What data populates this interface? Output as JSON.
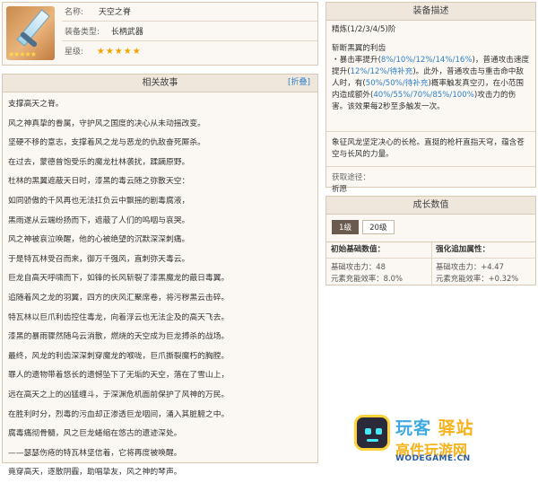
{
  "weapon": {
    "name_key": "名称:",
    "name": "天空之脊",
    "type_key": "装备类型:",
    "type": "长柄武器",
    "stars_key": "星级:",
    "stars": "★★★★★",
    "icon_stars": "★★★★★"
  },
  "story": {
    "title": "相关故事",
    "toggle": "[折叠]",
    "lines": [
      "支撑高天之脊。",
      "风之神真挚的眷属，守护风之国度的决心从未动摇改变。",
      "坚硬不移的意志，支撑着风之龙与恶龙的仇敌奋死厮杀。",
      "在过去，蒙德曾饱受乐的魔龙杜林袭扰，蹂躏原野。",
      "杜林的黑翼遮蔽天日时，漆黑的毒云随之弥散天空：",
      "如同骄傲的千风再也无法扛负云中飘摇的剧毒腐液，",
      "黑雨遂从云端纷扬而下，遮蔽了人们的呜咽与哀哭。",
      "风之神被哀泣唤醒，他的心被绝望的沉默深深刺痛。",
      "于是特瓦林受召而来，御万千强风，直刺弥天毒云。",
      "巨龙自高天呼啸而下，如锋的长风斩裂了漆黑魔龙的蔽日毒翼。",
      "追随着风之龙的羽翼，四方的庆风汇聚席卷，将污秽黑云击碎。",
      "特瓦林以巨爪利齿控住毒龙，向着浮云也无法企及的高天飞去。",
      "漆黑的暴雨骤然随乌云消散，燃烧的天空成为巨龙搏杀的战场。",
      "最终，风龙的利齿深深刺穿魔龙的喉咙，巨爪撕裂魔朽的胸膛。",
      "罪人的遗物带着悠长的遗憾坠下了无垢的天空，落在了雪山上，",
      "远在高天之上的凶猛缠斗，于深渊危机面前保护了风神的万民。",
      "在胜利时分，烈毒的污血却正渗透巨龙咽间，涌入其脏腑之中。",
      "腐毒痛彻骨髓，风之巨龙蜷缩在悠古的遗迹深处。",
      "——瑟瑟伤疮的特瓦林坚信着，它将再度被唤醒。",
      "竟穿高天，逐散阴霾，助唱挚友，风之神的琴声。"
    ]
  },
  "equip": {
    "title": "装备描述",
    "refine": "精炼(1/2/3/4/5)阶",
    "passive_name": "斩断黑翼的利齿",
    "effect1_pre": "・暴击率提升(",
    "effect1_vals": "8%/10%/12%/14%/16%",
    "effect1_post": ")，普通攻击速度提升(",
    "effect1_vals2": "12%/12%/待补充",
    "effect1_post2": ")。此外，普通攻击与重击命中敌人时，有(",
    "effect1_vals3": "50%/50%/待补充",
    "effect1_post3": ")概率触发真空刃，在小范围内造成额外(",
    "effect1_vals4": "40%/55%/70%/85%/100%",
    "effect1_post4": ")攻击力的伤害。该效果每2秒至多触发一次。",
    "lore": "象征风龙坚定决心的长枪。直挺的枪杆直指天穹，蕴含苍空与长风的力量。",
    "obtain_label": "获取途径：",
    "obtain": "祈愿"
  },
  "growth": {
    "title": "成长数值",
    "levels": [
      "1级",
      "20级"
    ],
    "base_header": "初始基础数值：",
    "base_atk": "基础攻击力：48",
    "base_er": "元素充能效率：8.0%",
    "bonus_header": "强化追加属性：",
    "bonus_atk": "基础攻击力：+4.47",
    "bonus_er": "元素充能效率：+0.32%"
  },
  "watermark": {
    "brand_a": "玩客",
    "brand_b": "驿站",
    "slogan": "高件玩游网",
    "domain": "WODEGAME.CN"
  },
  "colors": {
    "accent": "#2f7fc9",
    "star": "#f2a400",
    "panel_bg": "#fbf8f3",
    "header_bg": "#efe7dc"
  }
}
